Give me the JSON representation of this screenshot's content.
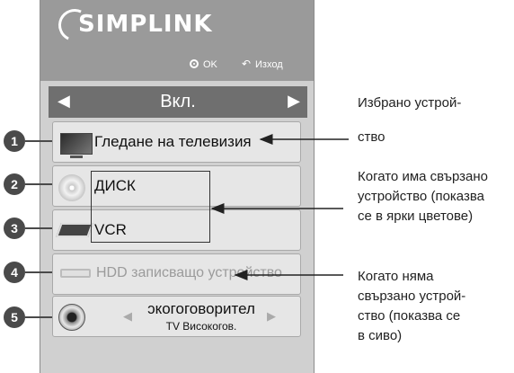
{
  "header": {
    "logo_text": "SIMPLINK",
    "hint_ok": "OK",
    "hint_exit": "Изход"
  },
  "selector": {
    "value": "Вкл.",
    "left_arrow": "◀",
    "right_arrow": "▶"
  },
  "devices": [
    {
      "badge": "1",
      "label": "Гледане на телевизия",
      "icon": "tv-icon",
      "state": "active"
    },
    {
      "badge": "2",
      "label": "ДИСК",
      "icon": "disc-icon",
      "state": "active"
    },
    {
      "badge": "3",
      "label": "VCR",
      "icon": "vcr-icon",
      "state": "active"
    },
    {
      "badge": "4",
      "label": "HDD записващо устройство",
      "icon": "hdd-icon",
      "state": "disabled"
    },
    {
      "badge": "5",
      "label": "Високоговорител",
      "sublabel": "TV Високогов.",
      "icon": "speaker-icon",
      "state": "active"
    }
  ],
  "speaker_visible": "ɔкогоговорител",
  "annotations": {
    "selected_line1": "Избрано устрой-",
    "selected_line2": "ство",
    "connected_line1": "Когато има свързано",
    "connected_line2": "устройство (показва",
    "connected_line3": "се в ярки цветове)",
    "disconnected_line1": "Когато няма",
    "disconnected_line2": "свързано устрой-",
    "disconnected_line3": "ство (показва се",
    "disconnected_line4": "в сиво)"
  },
  "colors": {
    "panel": "#d0d0d0",
    "header": "#9a9a9a",
    "selector": "#6f6f6f",
    "badge": "#4a4a4a"
  }
}
